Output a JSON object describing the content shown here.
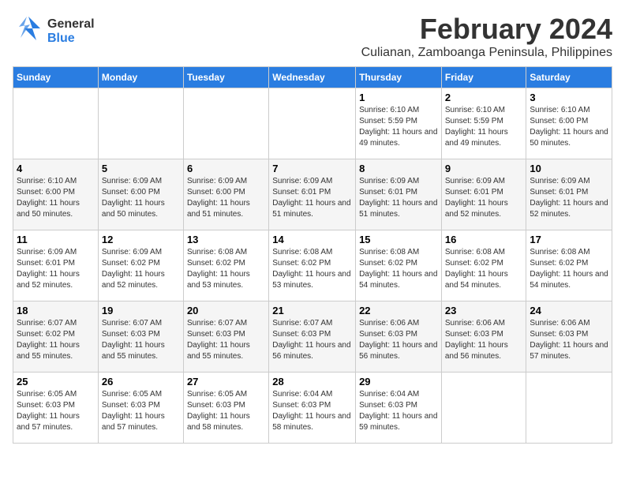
{
  "header": {
    "logo_general": "General",
    "logo_blue": "Blue",
    "month_title": "February 2024",
    "location": "Culianan, Zamboanga Peninsula, Philippines"
  },
  "calendar": {
    "days_of_week": [
      "Sunday",
      "Monday",
      "Tuesday",
      "Wednesday",
      "Thursday",
      "Friday",
      "Saturday"
    ],
    "weeks": [
      [
        {
          "day": "",
          "info": ""
        },
        {
          "day": "",
          "info": ""
        },
        {
          "day": "",
          "info": ""
        },
        {
          "day": "",
          "info": ""
        },
        {
          "day": "1",
          "info": "Sunrise: 6:10 AM\nSunset: 5:59 PM\nDaylight: 11 hours and 49 minutes."
        },
        {
          "day": "2",
          "info": "Sunrise: 6:10 AM\nSunset: 5:59 PM\nDaylight: 11 hours and 49 minutes."
        },
        {
          "day": "3",
          "info": "Sunrise: 6:10 AM\nSunset: 6:00 PM\nDaylight: 11 hours and 50 minutes."
        }
      ],
      [
        {
          "day": "4",
          "info": "Sunrise: 6:10 AM\nSunset: 6:00 PM\nDaylight: 11 hours and 50 minutes."
        },
        {
          "day": "5",
          "info": "Sunrise: 6:09 AM\nSunset: 6:00 PM\nDaylight: 11 hours and 50 minutes."
        },
        {
          "day": "6",
          "info": "Sunrise: 6:09 AM\nSunset: 6:00 PM\nDaylight: 11 hours and 51 minutes."
        },
        {
          "day": "7",
          "info": "Sunrise: 6:09 AM\nSunset: 6:01 PM\nDaylight: 11 hours and 51 minutes."
        },
        {
          "day": "8",
          "info": "Sunrise: 6:09 AM\nSunset: 6:01 PM\nDaylight: 11 hours and 51 minutes."
        },
        {
          "day": "9",
          "info": "Sunrise: 6:09 AM\nSunset: 6:01 PM\nDaylight: 11 hours and 52 minutes."
        },
        {
          "day": "10",
          "info": "Sunrise: 6:09 AM\nSunset: 6:01 PM\nDaylight: 11 hours and 52 minutes."
        }
      ],
      [
        {
          "day": "11",
          "info": "Sunrise: 6:09 AM\nSunset: 6:01 PM\nDaylight: 11 hours and 52 minutes."
        },
        {
          "day": "12",
          "info": "Sunrise: 6:09 AM\nSunset: 6:02 PM\nDaylight: 11 hours and 52 minutes."
        },
        {
          "day": "13",
          "info": "Sunrise: 6:08 AM\nSunset: 6:02 PM\nDaylight: 11 hours and 53 minutes."
        },
        {
          "day": "14",
          "info": "Sunrise: 6:08 AM\nSunset: 6:02 PM\nDaylight: 11 hours and 53 minutes."
        },
        {
          "day": "15",
          "info": "Sunrise: 6:08 AM\nSunset: 6:02 PM\nDaylight: 11 hours and 54 minutes."
        },
        {
          "day": "16",
          "info": "Sunrise: 6:08 AM\nSunset: 6:02 PM\nDaylight: 11 hours and 54 minutes."
        },
        {
          "day": "17",
          "info": "Sunrise: 6:08 AM\nSunset: 6:02 PM\nDaylight: 11 hours and 54 minutes."
        }
      ],
      [
        {
          "day": "18",
          "info": "Sunrise: 6:07 AM\nSunset: 6:02 PM\nDaylight: 11 hours and 55 minutes."
        },
        {
          "day": "19",
          "info": "Sunrise: 6:07 AM\nSunset: 6:03 PM\nDaylight: 11 hours and 55 minutes."
        },
        {
          "day": "20",
          "info": "Sunrise: 6:07 AM\nSunset: 6:03 PM\nDaylight: 11 hours and 55 minutes."
        },
        {
          "day": "21",
          "info": "Sunrise: 6:07 AM\nSunset: 6:03 PM\nDaylight: 11 hours and 56 minutes."
        },
        {
          "day": "22",
          "info": "Sunrise: 6:06 AM\nSunset: 6:03 PM\nDaylight: 11 hours and 56 minutes."
        },
        {
          "day": "23",
          "info": "Sunrise: 6:06 AM\nSunset: 6:03 PM\nDaylight: 11 hours and 56 minutes."
        },
        {
          "day": "24",
          "info": "Sunrise: 6:06 AM\nSunset: 6:03 PM\nDaylight: 11 hours and 57 minutes."
        }
      ],
      [
        {
          "day": "25",
          "info": "Sunrise: 6:05 AM\nSunset: 6:03 PM\nDaylight: 11 hours and 57 minutes."
        },
        {
          "day": "26",
          "info": "Sunrise: 6:05 AM\nSunset: 6:03 PM\nDaylight: 11 hours and 57 minutes."
        },
        {
          "day": "27",
          "info": "Sunrise: 6:05 AM\nSunset: 6:03 PM\nDaylight: 11 hours and 58 minutes."
        },
        {
          "day": "28",
          "info": "Sunrise: 6:04 AM\nSunset: 6:03 PM\nDaylight: 11 hours and 58 minutes."
        },
        {
          "day": "29",
          "info": "Sunrise: 6:04 AM\nSunset: 6:03 PM\nDaylight: 11 hours and 59 minutes."
        },
        {
          "day": "",
          "info": ""
        },
        {
          "day": "",
          "info": ""
        }
      ]
    ]
  }
}
